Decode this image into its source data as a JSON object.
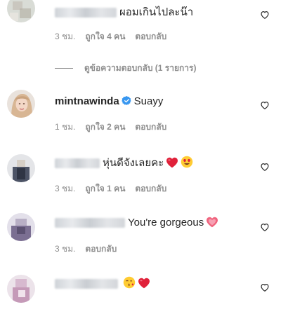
{
  "comments": [
    {
      "text": "ผอมเกินไปละน๊า",
      "time": "3 ชม.",
      "likes": "ถูกใจ 4 คน",
      "reply": "ตอบกลับ",
      "view_replies": "ดูข้อความตอบกลับ (1 รายการ)"
    },
    {
      "username": "mintnawinda",
      "text": "Suayy",
      "time": "1 ชม.",
      "likes": "ถูกใจ 2 คน",
      "reply": "ตอบกลับ"
    },
    {
      "text": "หุ่นดีจังเลยคะ",
      "time": "3 ชม.",
      "likes": "ถูกใจ 1 คน",
      "reply": "ตอบกลับ"
    },
    {
      "text": "You're gorgeous",
      "time": "3 ชม.",
      "reply": "ตอบกลับ"
    },
    {
      "text": "",
      "time": "",
      "reply": ""
    }
  ],
  "colors": {
    "text": "#262626",
    "muted": "#8e8e8e",
    "verified": "#3897f0",
    "heart_red": "#ed4956"
  },
  "icons": [
    "heart-outline-icon",
    "verified-badge-icon",
    "red-heart-emoji",
    "heart-eyes-emoji",
    "pink-heart-emoji",
    "kissing-heart-emoji"
  ]
}
